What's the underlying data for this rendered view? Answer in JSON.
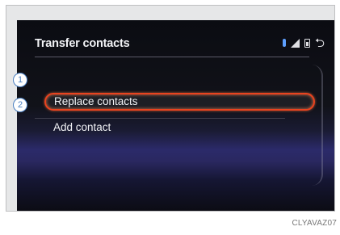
{
  "screen": {
    "title": "Transfer contacts",
    "status_icons": [
      "bluetooth-icon",
      "signal-icon",
      "battery-icon",
      "back-icon"
    ],
    "options": [
      {
        "number": "1",
        "label": "Replace contacts",
        "selected": true
      },
      {
        "number": "2",
        "label": "Add contact",
        "selected": false
      }
    ]
  },
  "figure_code": "CLYAVAZ07",
  "colors": {
    "highlight": "#e9431f",
    "callout": "#4a7fc1",
    "bluetooth": "#5ea0ff"
  }
}
